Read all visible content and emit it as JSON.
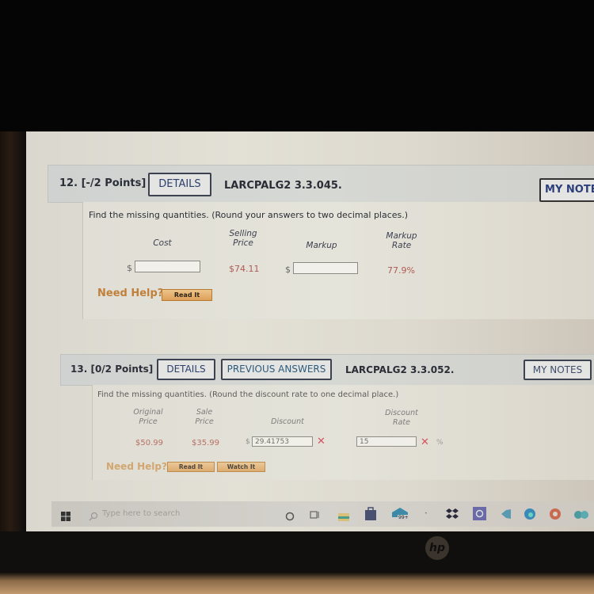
{
  "q12": {
    "number": "12.",
    "points": "[-/2 Points]",
    "details_label": "DETAILS",
    "code": "LARCPALG2 3.3.045.",
    "my_notes_label": "MY NOTES",
    "instruction": "Find the missing quantities. (Round your answers to two decimal places.)",
    "columns": {
      "cost": "Cost",
      "selling_price_1": "Selling",
      "selling_price_2": "Price",
      "markup": "Markup",
      "markup_rate_1": "Markup",
      "markup_rate_2": "Rate"
    },
    "row": {
      "cost_prefix": "$",
      "cost_value": "",
      "selling_price": "$74.11",
      "markup_prefix": "$",
      "markup_value": "",
      "markup_rate": "77.9%"
    },
    "need_help": "Need Help?",
    "read_it": "Read It"
  },
  "q13": {
    "number": "13.",
    "points": "[0/2 Points]",
    "details_label": "DETAILS",
    "previous_answers_label": "PREVIOUS ANSWERS",
    "code": "LARCPALG2 3.3.052.",
    "my_notes_label": "MY NOTES",
    "instruction": "Find the missing quantities. (Round the discount rate to one decimal place.)",
    "columns": {
      "original_price_1": "Original",
      "original_price_2": "Price",
      "sale_price_1": "Sale",
      "sale_price_2": "Price",
      "discount": "Discount",
      "discount_rate_1": "Discount",
      "discount_rate_2": "Rate"
    },
    "row": {
      "original_price": "$50.99",
      "sale_price": "$35.99",
      "discount_prefix": "$",
      "discount_value": "29.41753",
      "discount_rate_value": "15",
      "discount_rate_suffix": "%",
      "incorrect_mark": "✕"
    },
    "need_help": "Need Help?",
    "read_it": "Read It",
    "watch_it": "Watch It"
  },
  "taskbar": {
    "search_placeholder": "Type here to search",
    "mail_badge": "99+"
  },
  "laptop": {
    "brand": "hp"
  }
}
